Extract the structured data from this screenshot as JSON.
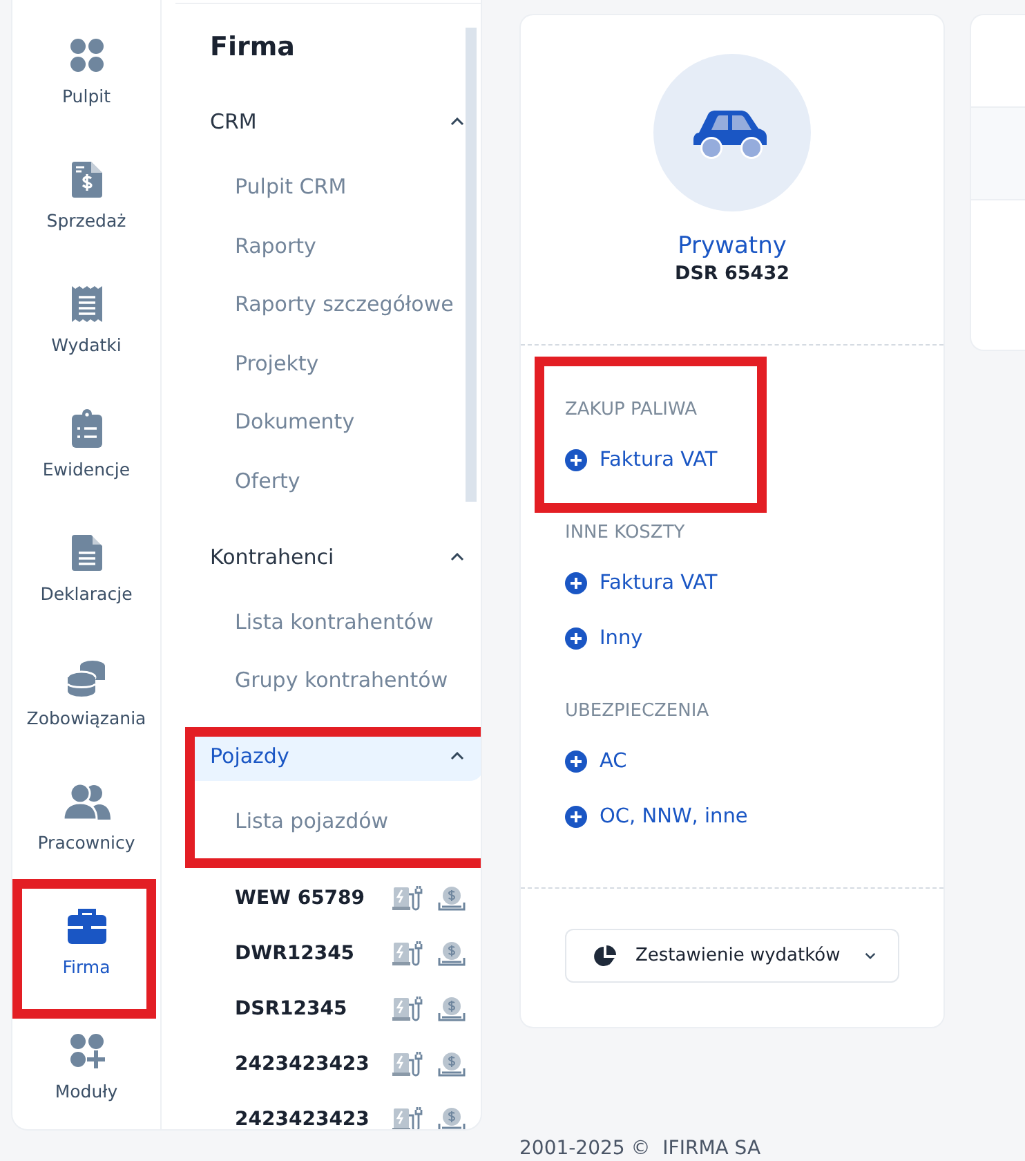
{
  "nav": [
    {
      "label": "Pulpit",
      "selected": false,
      "highlighted": false
    },
    {
      "label": "Sprzedaż",
      "selected": false,
      "highlighted": false
    },
    {
      "label": "Wydatki",
      "selected": false,
      "highlighted": false
    },
    {
      "label": "Ewidencje",
      "selected": false,
      "highlighted": false
    },
    {
      "label": "Deklaracje",
      "selected": false,
      "highlighted": false
    },
    {
      "label": "Zobowiązania",
      "selected": false,
      "highlighted": false
    },
    {
      "label": "Pracownicy",
      "selected": false,
      "highlighted": false
    },
    {
      "label": "Firma",
      "selected": true,
      "highlighted": true
    },
    {
      "label": "Moduły",
      "selected": false,
      "highlighted": false
    }
  ],
  "submenu": {
    "title": "Firma",
    "groups": [
      {
        "label": "CRM",
        "expanded": true,
        "selected": false,
        "highlighted": false,
        "items": [
          "Pulpit CRM",
          "Raporty",
          "Raporty szczegółowe",
          "Projekty",
          "Dokumenty",
          "Oferty"
        ]
      },
      {
        "label": "Kontrahenci",
        "expanded": true,
        "selected": false,
        "highlighted": false,
        "items": [
          "Lista kontrahentów",
          "Grupy kontrahentów"
        ]
      },
      {
        "label": "Pojazdy",
        "expanded": true,
        "selected": true,
        "highlighted": true,
        "items": [
          "Lista pojazdów"
        ]
      }
    ],
    "vehicles": [
      {
        "plate": "WEW 65789"
      },
      {
        "plate": "DWR12345"
      },
      {
        "plate": "DSR12345"
      },
      {
        "plate": "2423423423"
      },
      {
        "plate": "2423423423"
      }
    ]
  },
  "vehicle_card": {
    "name": "Prywatny",
    "plate": "DSR 65432",
    "sections": [
      {
        "title": "ZAKUP PALIWA",
        "highlighted": true,
        "actions": [
          "Faktura VAT"
        ]
      },
      {
        "title": "INNE KOSZTY",
        "highlighted": false,
        "actions": [
          "Faktura VAT",
          "Inny"
        ]
      },
      {
        "title": "UBEZPIECZENIA",
        "highlighted": false,
        "actions": [
          "AC",
          "OC, NNW, inne"
        ]
      }
    ],
    "report_button": {
      "label": "Zestawienie wydatków"
    }
  },
  "footer": "2001-2025 ©  IFIRMA SA"
}
